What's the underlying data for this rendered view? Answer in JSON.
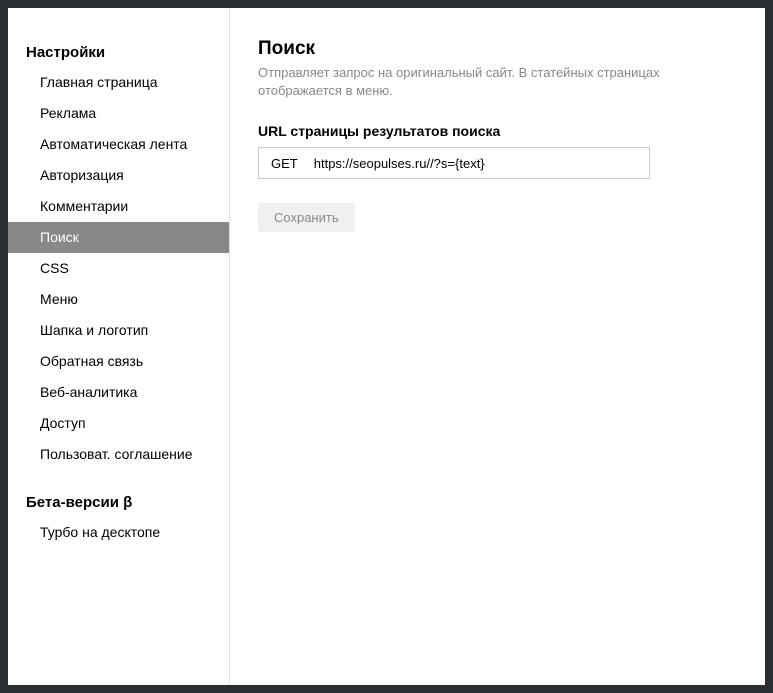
{
  "sidebar": {
    "section1": {
      "title": "Настройки",
      "items": [
        {
          "label": "Главная страница"
        },
        {
          "label": "Реклама"
        },
        {
          "label": "Автоматическая лента"
        },
        {
          "label": "Авторизация"
        },
        {
          "label": "Комментарии"
        },
        {
          "label": "Поиск",
          "active": true
        },
        {
          "label": "CSS"
        },
        {
          "label": "Меню"
        },
        {
          "label": "Шапка и логотип"
        },
        {
          "label": "Обратная связь"
        },
        {
          "label": "Веб-аналитика"
        },
        {
          "label": "Доступ"
        },
        {
          "label": "Пользоват. соглашение"
        }
      ]
    },
    "section2": {
      "title": "Бета-версии β",
      "items": [
        {
          "label": "Турбо на десктопе"
        }
      ]
    }
  },
  "main": {
    "title": "Поиск",
    "description": "Отправляет запрос на оригинальный сайт. В статейных страницах отображается в меню.",
    "field_label": "URL страницы результатов поиска",
    "method": "GET",
    "url_value": "https://seopulses.ru//?s={text}",
    "save_label": "Сохранить"
  }
}
